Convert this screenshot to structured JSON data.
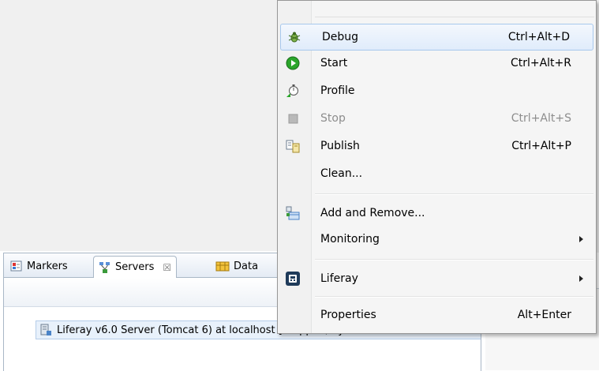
{
  "menu": {
    "items": [
      {
        "label": "Debug",
        "accel": "Ctrl+Alt+D",
        "icon": "debug-bug-icon"
      },
      {
        "label": "Start",
        "accel": "Ctrl+Alt+R",
        "icon": "start-play-icon"
      },
      {
        "label": "Profile",
        "accel": "",
        "icon": "profile-stopwatch-icon"
      },
      {
        "label": "Stop",
        "accel": "Ctrl+Alt+S",
        "icon": "stop-square-icon"
      },
      {
        "label": "Publish",
        "accel": "Ctrl+Alt+P",
        "icon": "publish-icon"
      },
      {
        "label": "Clean...",
        "accel": "",
        "icon": ""
      },
      {
        "label": "Add and Remove...",
        "accel": "",
        "icon": "add-remove-icon"
      },
      {
        "label": "Monitoring",
        "accel": "",
        "icon": ""
      },
      {
        "label": "Liferay",
        "accel": "",
        "icon": "liferay-icon"
      },
      {
        "label": "Properties",
        "accel": "Alt+Enter",
        "icon": ""
      }
    ]
  },
  "view": {
    "tabs": [
      {
        "label": "Markers",
        "icon": "markers-icon"
      },
      {
        "label": "Servers",
        "icon": "servers-icon",
        "close": "☒"
      },
      {
        "label": "Data",
        "icon": "data-source-icon"
      }
    ],
    "server_row": "Liferay v6.0 Server (Tomcat 6) at localhost  [Stopped, Synchron"
  },
  "colors": {
    "highlight": "#e0ecfb",
    "start_green": "#2aa52a",
    "view_border": "#a9b7c6"
  }
}
